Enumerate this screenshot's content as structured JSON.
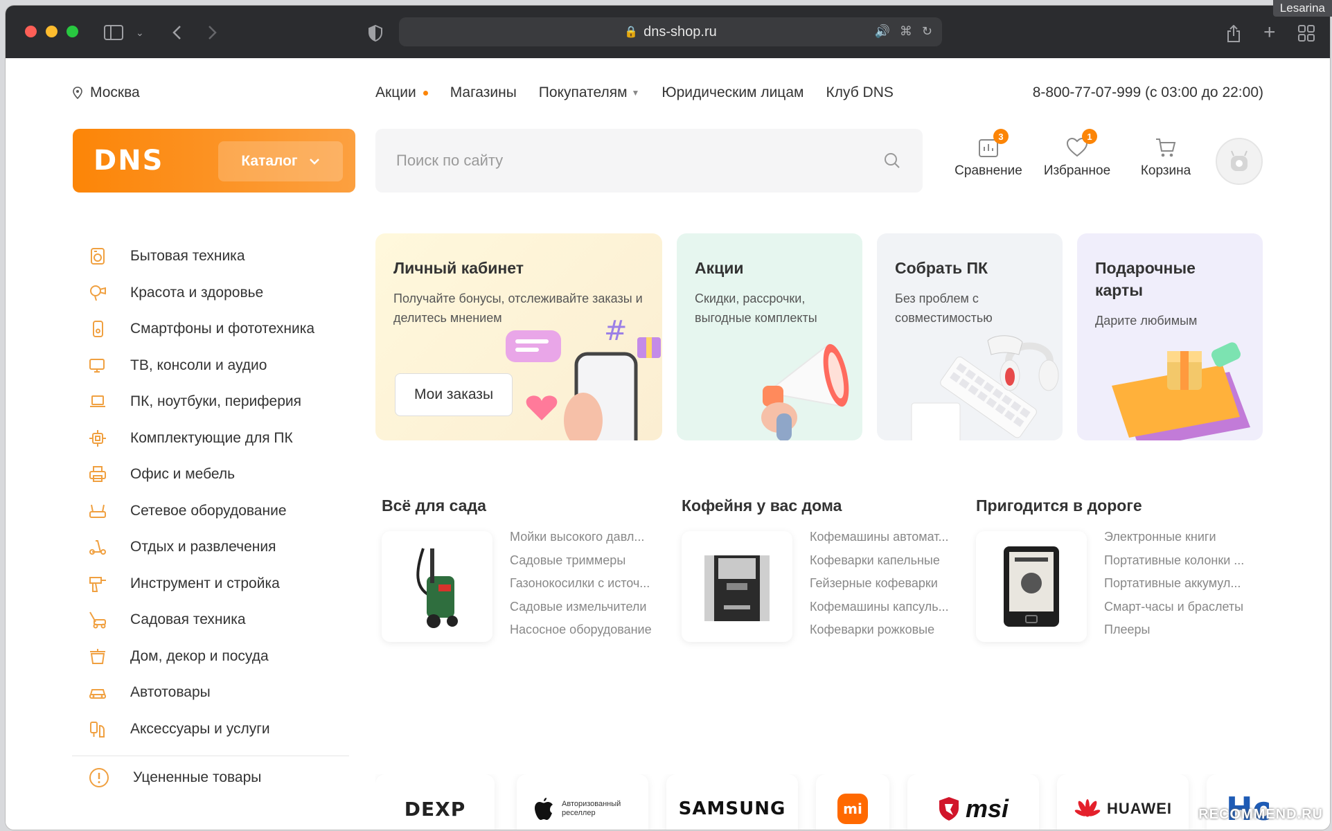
{
  "browser": {
    "url": "dns-shop.ru",
    "corner_label": "Lesarina"
  },
  "topnav": {
    "city": "Москва",
    "links": [
      {
        "label": "Акции"
      },
      {
        "label": "Магазины"
      },
      {
        "label": "Покупателям"
      },
      {
        "label": "Юридическим лицам"
      },
      {
        "label": "Клуб DNS"
      }
    ],
    "phone": "8-800-77-07-999 (с 03:00 до 22:00)"
  },
  "header": {
    "logo": "DNS",
    "catalog_label": "Каталог",
    "search_placeholder": "Поиск по сайту",
    "actions": [
      {
        "label": "Сравнение",
        "badge": "3",
        "icon": "compare-icon"
      },
      {
        "label": "Избранное",
        "badge": "1",
        "icon": "heart-icon"
      },
      {
        "label": "Корзина",
        "badge": "",
        "icon": "cart-icon"
      }
    ]
  },
  "sidebar": {
    "items": [
      {
        "label": "Бытовая техника",
        "icon": "washing-machine-icon"
      },
      {
        "label": "Красота и здоровье",
        "icon": "hair-dryer-icon"
      },
      {
        "label": "Смартфоны и фототехника",
        "icon": "smartphone-icon"
      },
      {
        "label": "ТВ, консоли и аудио",
        "icon": "tv-icon"
      },
      {
        "label": "ПК, ноутбуки, периферия",
        "icon": "laptop-icon"
      },
      {
        "label": "Комплектующие для ПК",
        "icon": "chip-icon"
      },
      {
        "label": "Офис и мебель",
        "icon": "printer-icon"
      },
      {
        "label": "Сетевое оборудование",
        "icon": "router-icon"
      },
      {
        "label": "Отдых и развлечения",
        "icon": "scooter-icon"
      },
      {
        "label": "Инструмент и стройка",
        "icon": "drill-icon"
      },
      {
        "label": "Садовая техника",
        "icon": "lawnmower-icon"
      },
      {
        "label": "Дом, декор и посуда",
        "icon": "pot-icon"
      },
      {
        "label": "Автотовары",
        "icon": "car-icon"
      },
      {
        "label": "Аксессуары и услуги",
        "icon": "accessories-icon"
      }
    ],
    "bottom_item": {
      "label": "Уцененные товары",
      "icon": "exclamation-icon"
    }
  },
  "promos": [
    {
      "title": "Личный кабинет",
      "text": "Получайте бонусы, отслеживайте заказы и делитесь мнением",
      "button": "Мои заказы"
    },
    {
      "title": "Акции",
      "text": "Скидки, рассрочки, выгодные комплекты"
    },
    {
      "title": "Собрать ПК",
      "text": "Без проблем с совместимостью"
    },
    {
      "title": "Подарочные карты",
      "text": "Дарите любимым"
    }
  ],
  "collections": [
    {
      "title": "Всё для сада",
      "items": [
        "Мойки высокого давл...",
        "Садовые триммеры",
        "Газонокосилки с источ...",
        "Садовые измельчители",
        "Насосное оборудование"
      ]
    },
    {
      "title": "Кофейня у вас дома",
      "items": [
        "Кофемашины автомат...",
        "Кофеварки капельные",
        "Гейзерные кофеварки",
        "Кофемашины капсуль...",
        "Кофеварки рожковые"
      ]
    },
    {
      "title": "Пригодится в дороге",
      "items": [
        "Электронные книги",
        "Портативные колонки ...",
        "Портативные аккумул...",
        "Смарт-часы и браслеты",
        "Плееры"
      ]
    }
  ],
  "brands": [
    {
      "name": "DEXP"
    },
    {
      "name": "Apple",
      "caption": "Авторизованный реселлер"
    },
    {
      "name": "SAMSUNG"
    },
    {
      "name": "mi"
    },
    {
      "name": "msi"
    },
    {
      "name": "HUAWEI"
    },
    {
      "name": "Ho"
    }
  ],
  "watermark": "RECOMMEND.RU",
  "colors": {
    "accent": "#fc8507",
    "green_promo": "#e6f6ef",
    "purple_promo": "#f0eefb"
  }
}
